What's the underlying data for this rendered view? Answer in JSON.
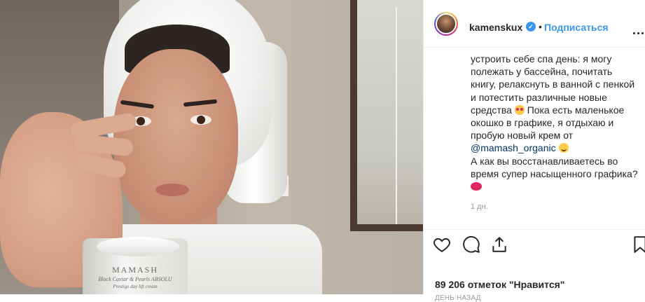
{
  "post": {
    "image_alt": "Photo of a woman in a white towel holding a jar of cream",
    "jar": {
      "brand": "MAMASH",
      "line1": "Black Caviar & Pearls ABSOLU",
      "line2": "Prestige day lift cream"
    }
  },
  "header": {
    "username": "kamenskux",
    "verified_mark": "✓",
    "separator": "•",
    "follow_label": "Подписаться"
  },
  "caption": {
    "part1": "устроить себе спа день: я могу полежать у бассейна, почитать книгу, релакснуть в ванной с пенкой и потестить различные новые средства",
    "part2": "Пока есть маленькое окошко в графике, я отдыхаю и пробую новый крем от",
    "mention": "@mamash_organic",
    "part3": "А как вы восстанавливаетесь во время супер насыщенного графика?"
  },
  "comment_time": "1 дн.",
  "actions": {
    "icons": [
      "heart-icon",
      "comment-icon",
      "share-icon",
      "bookmark-icon"
    ]
  },
  "likes_text": "89 206 отметок \"Нравится\"",
  "post_date": "ДЕНЬ НАЗАД"
}
